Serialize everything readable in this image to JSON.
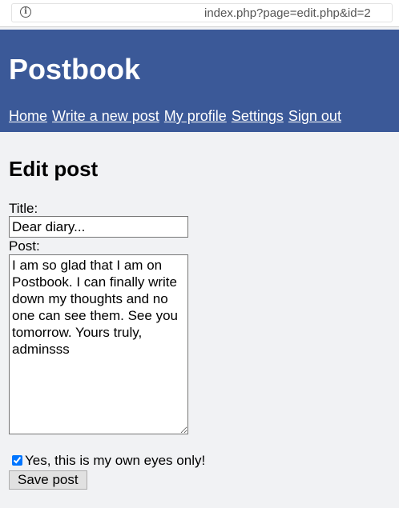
{
  "browser": {
    "url": "index.php?page=edit.php&id=2",
    "info_icon": "info-icon"
  },
  "site": {
    "title": "Postbook"
  },
  "nav": {
    "items": [
      {
        "label": "Home"
      },
      {
        "label": "Write a new post"
      },
      {
        "label": "My profile"
      },
      {
        "label": "Settings"
      },
      {
        "label": "Sign out"
      }
    ]
  },
  "colors": {
    "header_bg": "#3b5998",
    "page_bg": "#f1f2f4"
  },
  "form": {
    "heading": "Edit post",
    "title_label": "Title:",
    "title_value": "Dear diary...",
    "post_label": "Post:",
    "post_value": "I am so glad that I am on Postbook. I can finally write down my thoughts and no one can see them. See you tomorrow. Yours truly, adminsss",
    "private_checked": true,
    "private_label": "Yes, this is my own eyes only!",
    "save_label": "Save post"
  }
}
